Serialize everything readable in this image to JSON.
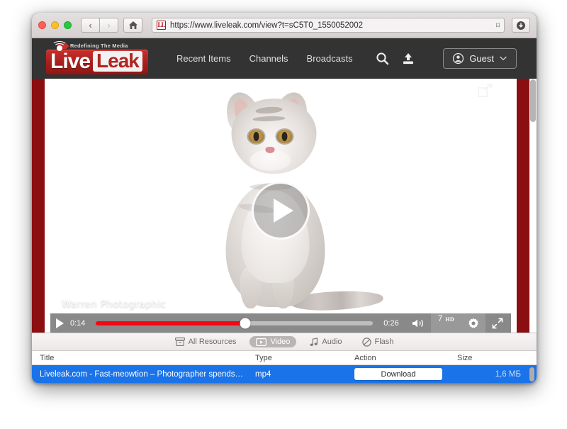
{
  "browser": {
    "traffic_lights": [
      "close",
      "minimize",
      "zoom"
    ],
    "back_label": "‹",
    "forward_label": "›",
    "home_icon": "home-icon",
    "favicon_text": "LL",
    "url": "https://www.liveleak.com/view?t=sC5T0_1550052002",
    "bookmark_icon": "bookmark-icon",
    "download_icon": "download-icon"
  },
  "site": {
    "tagline": "Redefining The Media",
    "logo_first": "Live",
    "logo_second": "Leak",
    "nav": [
      {
        "label": "Recent Items"
      },
      {
        "label": "Channels"
      },
      {
        "label": "Broadcasts"
      }
    ],
    "search_icon": "search-icon",
    "upload_icon": "upload-icon",
    "account_label": "Guest",
    "account_chevron": "⌄"
  },
  "player": {
    "watermark": "Warren Photographic",
    "play_overlay": "play-icon",
    "current_time": "0:14",
    "duration": "0:26",
    "progress_percent": 54,
    "quality_number": "7",
    "quality_hd": "HD",
    "volume_icon": "volume-icon",
    "settings_icon": "gear-icon",
    "fullscreen_icon": "fullscreen-icon",
    "popout_icon": "popout-icon"
  },
  "downloader": {
    "filters": [
      {
        "label": "All Resources",
        "icon": "archive-icon",
        "active": false
      },
      {
        "label": "Video",
        "icon": "video-icon",
        "active": true
      },
      {
        "label": "Audio",
        "icon": "music-note-icon",
        "active": false
      },
      {
        "label": "Flash",
        "icon": "no-entry-icon",
        "active": false
      }
    ],
    "columns": {
      "title": "Title",
      "type": "Type",
      "action": "Action",
      "size": "Size"
    },
    "rows": [
      {
        "title": "Liveleak.com - Fast-meowtion – Photographer spends…",
        "type": "mp4",
        "action": "Download",
        "size": "1,6 МБ"
      }
    ]
  },
  "colors": {
    "accent_red": "#b02420",
    "gutter_red": "#8b0e11",
    "selection_blue": "#1a73e8",
    "header_dark": "#333333",
    "progress_red": "#f40612"
  }
}
